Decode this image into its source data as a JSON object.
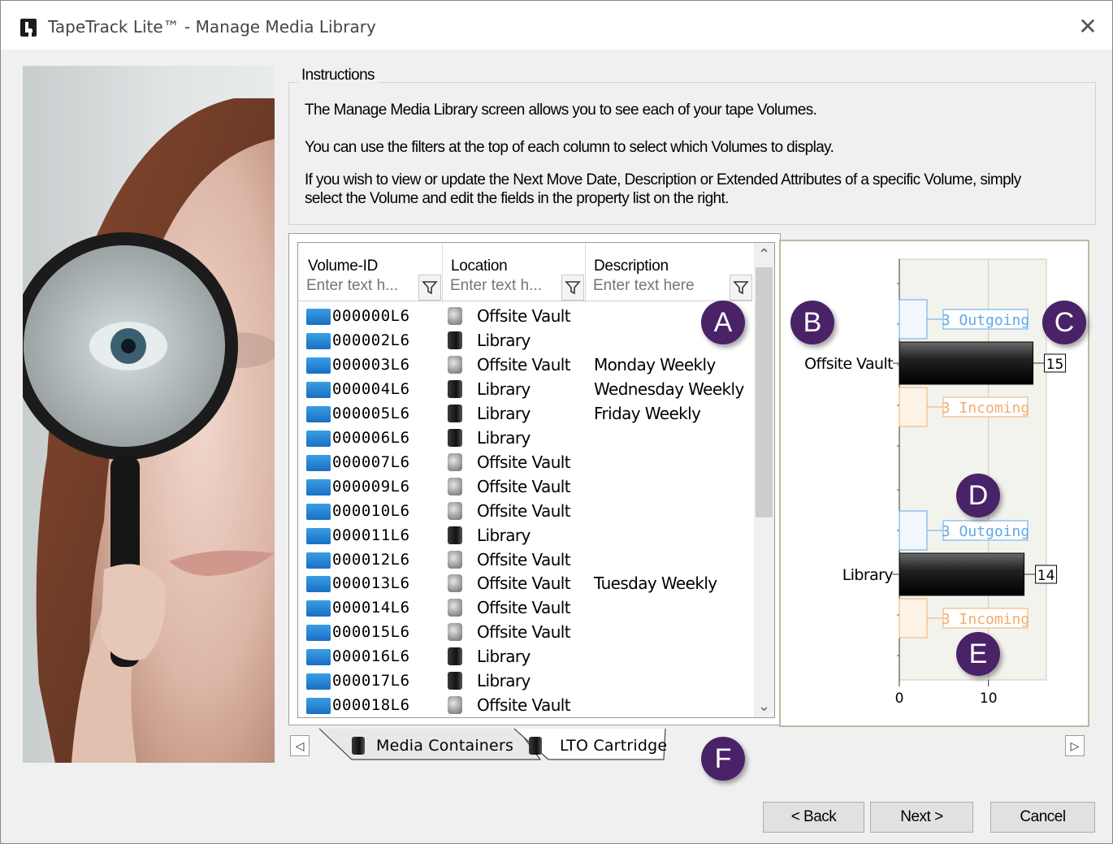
{
  "window": {
    "title": "TapeTrack Lite™ - Manage Media Library"
  },
  "instructions": {
    "legend": "Instructions",
    "line1": "The Manage Media Library screen allows you to see each of your tape Volumes.",
    "line2": "You can use the filters at the top of each column to select which Volumes to display.",
    "line3a": "If you wish to view or update the Next Move Date, Description or Extended Attributes of a specific Volume, simply",
    "line3b": "select the Volume and edit the fields in the property list on the right."
  },
  "grid": {
    "columns": [
      {
        "label": "Volume-ID",
        "placeholder": "Enter text h..."
      },
      {
        "label": "Location",
        "placeholder": "Enter text h..."
      },
      {
        "label": "Description",
        "placeholder": "Enter text here"
      }
    ],
    "rows": [
      {
        "id": "000000L6",
        "location": "Offsite Vault",
        "loc_type": "vault",
        "description": ""
      },
      {
        "id": "000002L6",
        "location": "Library",
        "loc_type": "lib",
        "description": ""
      },
      {
        "id": "000003L6",
        "location": "Offsite Vault",
        "loc_type": "vault",
        "description": "Monday Weekly"
      },
      {
        "id": "000004L6",
        "location": "Library",
        "loc_type": "lib",
        "description": "Wednesday Weekly"
      },
      {
        "id": "000005L6",
        "location": "Library",
        "loc_type": "lib",
        "description": "Friday Weekly"
      },
      {
        "id": "000006L6",
        "location": "Library",
        "loc_type": "lib",
        "description": ""
      },
      {
        "id": "000007L6",
        "location": "Offsite Vault",
        "loc_type": "vault",
        "description": ""
      },
      {
        "id": "000009L6",
        "location": "Offsite Vault",
        "loc_type": "vault",
        "description": ""
      },
      {
        "id": "000010L6",
        "location": "Offsite Vault",
        "loc_type": "vault",
        "description": ""
      },
      {
        "id": "000011L6",
        "location": "Library",
        "loc_type": "lib",
        "description": ""
      },
      {
        "id": "000012L6",
        "location": "Offsite Vault",
        "loc_type": "vault",
        "description": ""
      },
      {
        "id": "000013L6",
        "location": "Offsite Vault",
        "loc_type": "vault",
        "description": "Tuesday Weekly"
      },
      {
        "id": "000014L6",
        "location": "Offsite Vault",
        "loc_type": "vault",
        "description": ""
      },
      {
        "id": "000015L6",
        "location": "Offsite Vault",
        "loc_type": "vault",
        "description": ""
      },
      {
        "id": "000016L6",
        "location": "Library",
        "loc_type": "lib",
        "description": ""
      },
      {
        "id": "000017L6",
        "location": "Library",
        "loc_type": "lib",
        "description": ""
      },
      {
        "id": "000018L6",
        "location": "Offsite Vault",
        "loc_type": "vault",
        "description": ""
      }
    ]
  },
  "chart_data": {
    "type": "bar",
    "orientation": "horizontal",
    "categories": [
      "Offsite Vault",
      "Library"
    ],
    "series": [
      {
        "values": [
          15,
          14
        ],
        "data_labels": [
          "15",
          "14"
        ],
        "color": "#1a1a1a"
      }
    ],
    "annotations": [
      {
        "category": "Offsite Vault",
        "outgoing": "3 Outgoing",
        "incoming": "3 Incoming"
      },
      {
        "category": "Library",
        "outgoing": "3 Outgoing",
        "incoming": "3 Incoming"
      }
    ],
    "x_ticks": [
      "0",
      "10"
    ],
    "xlim": [
      0,
      16.5
    ],
    "grid": true,
    "colors": {
      "outgoing": "#5ea8e8",
      "incoming": "#f2ad6a"
    }
  },
  "tabs": {
    "items": [
      {
        "label": "Media Containers"
      },
      {
        "label": "LTO Cartridge"
      }
    ],
    "scroll_left": "◁",
    "scroll_right": "▷"
  },
  "badges": [
    "A",
    "B",
    "C",
    "D",
    "E",
    "F"
  ],
  "buttons": {
    "back": "< Back",
    "next": "Next >",
    "cancel": "Cancel"
  },
  "colors": {
    "badge": "#4a2268",
    "vol_icon": "#1a6fc4"
  }
}
